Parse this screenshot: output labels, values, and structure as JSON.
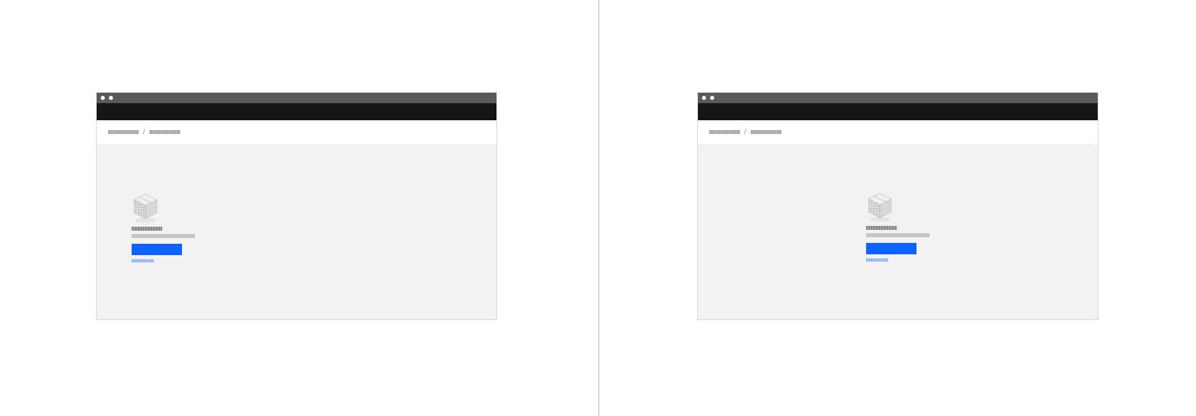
{
  "panels": [
    {
      "breadcrumb": {
        "items": [
          "",
          ""
        ],
        "separator": "/"
      },
      "empty_state": {
        "icon": "package-box-icon",
        "title": "",
        "description": "",
        "primary_button_label": "",
        "link_label": ""
      }
    },
    {
      "breadcrumb": {
        "items": [
          "",
          ""
        ],
        "separator": "/"
      },
      "empty_state": {
        "icon": "package-box-icon",
        "title": "",
        "description": "",
        "primary_button_label": "",
        "link_label": ""
      }
    }
  ],
  "colors": {
    "chrome": "#5a5a5a",
    "masthead": "#161616",
    "content_background": "#f2f2f2",
    "primary_button": "#0f62fe",
    "link": "#78a9ff"
  }
}
